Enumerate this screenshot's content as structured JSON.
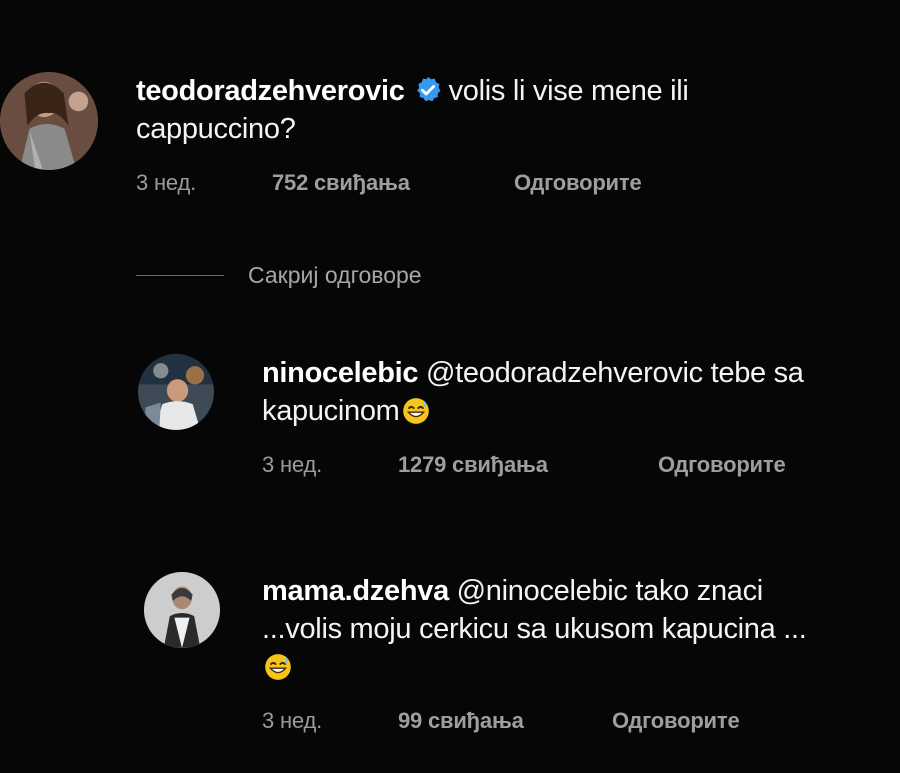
{
  "comments": [
    {
      "username": "teodoradzehverovic",
      "verified": true,
      "text": "volis li vise mene ili cappuccino?",
      "time": "3 нед.",
      "likes": "752 свиђања",
      "reply": "Одговорите"
    },
    {
      "username": "ninocelebic",
      "text": "@teodoradzehverovic tebe sa kapucinom",
      "emoji": "grinning-sweat-emoji",
      "time": "3 нед.",
      "likes": "1279 свиђања",
      "reply": "Одговорите"
    },
    {
      "username": "mama.dzehva",
      "text": "@ninocelebic tako znaci ...volis moju cerkicu sa ukusom kapucina ...",
      "emoji": "grinning-sweat-emoji",
      "time": "3 нед.",
      "likes": "99 свиђања",
      "reply": "Одговорите"
    }
  ],
  "hide_replies_label": "Сакриј одговоре",
  "colors": {
    "background": "#060606",
    "text": "#f4f4f4",
    "meta": "#9b9b9b",
    "verified": "#3897f0",
    "emoji": "#f5c518"
  }
}
